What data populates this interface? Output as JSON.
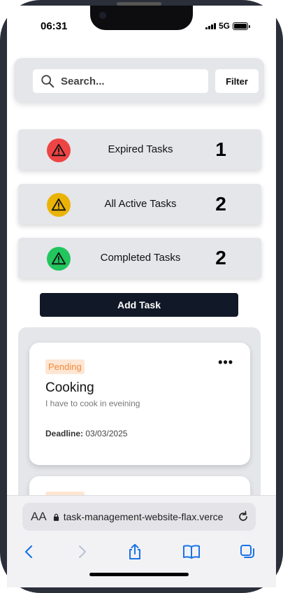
{
  "status": {
    "time": "06:31",
    "network": "5G"
  },
  "search": {
    "placeholder": "Search...",
    "filter_label": "Filter"
  },
  "stats": [
    {
      "label": "Expired Tasks",
      "count": "1",
      "color": "#ef4444"
    },
    {
      "label": "All Active Tasks",
      "count": "2",
      "color": "#eab308"
    },
    {
      "label": "Completed Tasks",
      "count": "2",
      "color": "#22c55e"
    }
  ],
  "actions": {
    "add_task_label": "Add Task"
  },
  "tasks": [
    {
      "status": "Pending",
      "title": "Cooking",
      "description": "I have to cook in eveining",
      "deadline_label": "Deadline:",
      "deadline": "03/03/2025"
    }
  ],
  "browser": {
    "text_size_label": "AA",
    "url": "task-management-website-flax.verce"
  }
}
